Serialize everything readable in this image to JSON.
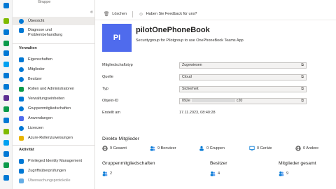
{
  "sidebar": {
    "group_label": "Gruppe",
    "items": [
      {
        "label": "Übersicht",
        "icon": "info-icon",
        "color": "#0078d4",
        "selected": true
      },
      {
        "label": "Diagnose und Problembehandlung",
        "icon": "wrench-icon",
        "color": "#0078d4"
      }
    ],
    "sections": [
      {
        "title": "Verwalten",
        "items": [
          {
            "label": "Eigenschaften",
            "icon": "properties-icon",
            "color": "#0078d4"
          },
          {
            "label": "Mitglieder",
            "icon": "members-icon",
            "color": "#0078d4"
          },
          {
            "label": "Besitzer",
            "icon": "owners-icon",
            "color": "#0078d4"
          },
          {
            "label": "Rollen und Administratoren",
            "icon": "roles-icon",
            "color": "#0b9a4a"
          },
          {
            "label": "Verwaltungseinheiten",
            "icon": "admin-units-icon",
            "color": "#0078d4"
          },
          {
            "label": "Gruppenmitgliedschaften",
            "icon": "group-memberships-icon",
            "color": "#0078d4"
          },
          {
            "label": "Anwendungen",
            "icon": "applications-icon",
            "color": "#4f6bed"
          },
          {
            "label": "Lizenzen",
            "icon": "licenses-icon",
            "color": "#0078d4"
          },
          {
            "label": "Azure-Rollenzuweisungen",
            "icon": "key-icon",
            "color": "#e8b400"
          }
        ]
      },
      {
        "title": "Aktivität",
        "items": [
          {
            "label": "Privileged Identity Management",
            "icon": "pim-icon",
            "color": "#0078d4"
          },
          {
            "label": "Zugriffsüberprüfungen",
            "icon": "access-review-icon",
            "color": "#0078d4"
          },
          {
            "label": "Überwachungsprotokolle",
            "icon": "audit-log-icon",
            "color": "#0078d4"
          }
        ]
      }
    ]
  },
  "toolbar": {
    "delete_label": "Löschen",
    "feedback_label": "Haben Sie Feedback für uns?"
  },
  "header": {
    "initials": "PI",
    "title": "pilotOnePhoneBook",
    "description": "Securitygroup for Pilotgroup to use OnePhoneBook Teams App"
  },
  "properties": {
    "membership_type": {
      "label": "Mitgliedschaftstyp",
      "value": "Zugewiesen"
    },
    "source": {
      "label": "Quelle",
      "value": "Cloud"
    },
    "type": {
      "label": "Typ",
      "value": "Sicherheit"
    },
    "object_id": {
      "label": "Objekt-ID",
      "value_start": "092e",
      "value_end": "c20"
    },
    "created": {
      "label": "Erstellt am",
      "value": "17.11.2023, 08:40:28"
    }
  },
  "direct_members": {
    "title": "Direkte Mitglieder",
    "total": "9 Gesamt",
    "users": "9 Benutzer",
    "groups": "0 Gruppen",
    "devices": "0 Geräte",
    "others": "0 Andere"
  },
  "stats": {
    "memberships_title": "Gruppenmitgliedschaften",
    "memberships_value": "2",
    "owners_title": "Besitzer",
    "owners_value": "4",
    "total_members_title": "Mitglieder gesamt",
    "total_members_value": "9"
  },
  "colors": {
    "accent": "#0078d4",
    "avatar": "#4f6bed"
  }
}
